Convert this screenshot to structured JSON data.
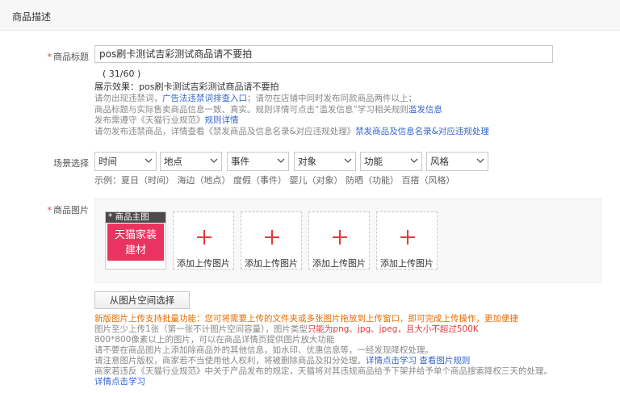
{
  "section": {
    "title": "商品描述"
  },
  "title_field": {
    "label": "商品标题",
    "value": "pos刷卡测试吉彩测试商品请不要拍",
    "count": "( 31/60 )",
    "preview": "展示效果：pos刷卡测试吉彩测试商品请不要拍"
  },
  "tips": {
    "line1_a": "请勿出现违禁词，",
    "line1_link": "广告法违禁词排查入口",
    "line1_b": "；请勿在店铺中同时发布同款商品两件以上；",
    "line2_a": "商品标题与实际售卖商品信息一致、真实。规则详情可点击“滥发信息”学习相关规则",
    "line2_link": "滥发信息",
    "line3_a": "发布需遵守《天猫行业规范》",
    "line3_link": "规则详情",
    "line4_a": "请勿发布违禁商品，详情查看《禁发商品及信息名录&对应违规处理》",
    "line4_link": "禁发商品及信息名录&对应违规处理"
  },
  "scene": {
    "label": "场景选择",
    "selects": [
      "时间",
      "地点",
      "事件",
      "对象",
      "功能",
      "风格"
    ],
    "example": "示例：夏日（时间） 海边（地点） 度假（事件） 婴儿（对象） 防晒（功能） 百搭（风格）"
  },
  "images": {
    "label": "商品图片",
    "main_tag": "* 商品主图",
    "main_text_1": "天猫家装",
    "main_text_2": "建材",
    "upload_label": "添加上传图片",
    "space_button": "从图片空间选择"
  },
  "image_tips": {
    "l1": "新版图片上传支持批量功能：您可将需要上传的文件夹或多张图片拖放到上传窗口，即可完成上传操作，更加便捷",
    "l2_a": "图片至少上传1张（第一张不计图片空间容量），图片类型",
    "l2_red": "只能为png、jpg、jpeg，且大小不超过500K",
    "l3": "800*800像素以上的图片，可以在商品详情页提供图片放大功能",
    "l4": "请不要在商品图片上添加除商品外的其他信息，如水印、优惠信息等，一经发现降权处理。",
    "l5_a": "请注意图片版权，商家若不当使用他人权利，将被删除商品及扣分处理。",
    "l5_link1": "详情点击学习",
    "l5_link2": "查看图片规则",
    "l6": "商家若违反《天猫行业规范》中关于产品发布的规定，天猫将对其违规商品给予下架并给予单个商品搜索降权三天的处理。",
    "l7_link": "详情点击学习"
  }
}
